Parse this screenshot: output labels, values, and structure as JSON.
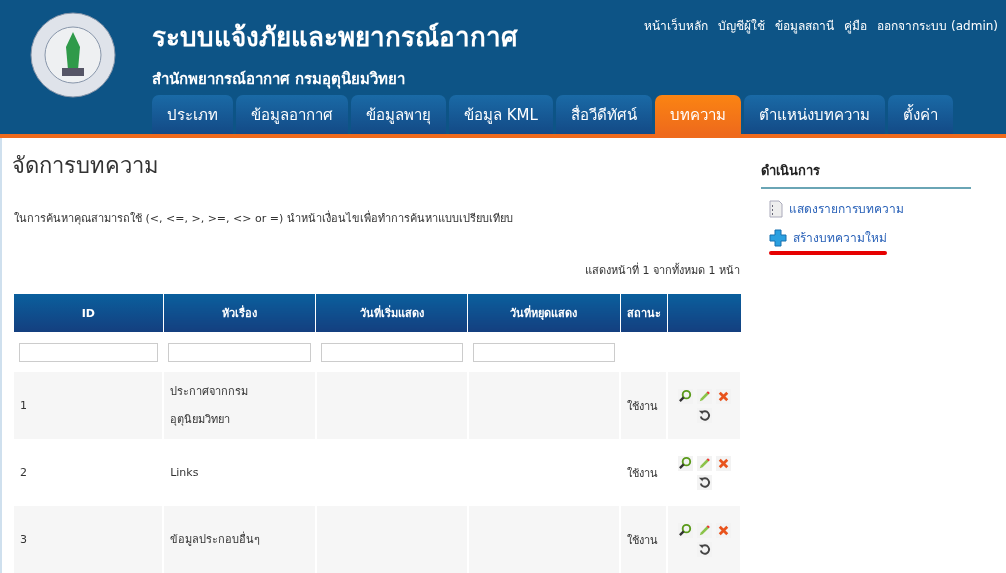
{
  "header": {
    "title": "ระบบแจ้งภัยและพยากรณ์อากาศ",
    "subtitle": "สำนักพยากรณ์อากาศ กรมอุตุนิยมวิทยา",
    "top_links": [
      "หน้าเว็บหลัก",
      "บัญชีผู้ใช้",
      "ข้อมูลสถานี",
      "คู่มือ",
      "ออกจากระบบ (admin)"
    ]
  },
  "tabs": [
    {
      "label": "ประเภท",
      "selected": false
    },
    {
      "label": "ข้อมูลอากาศ",
      "selected": false
    },
    {
      "label": "ข้อมูลพายุ",
      "selected": false
    },
    {
      "label": "ข้อมูล KML",
      "selected": false
    },
    {
      "label": "สื่อวีดีทัศน์",
      "selected": false
    },
    {
      "label": "บทความ",
      "selected": true
    },
    {
      "label": "ตำแหน่งบทความ",
      "selected": false
    },
    {
      "label": "ตั้งค่า",
      "selected": false
    }
  ],
  "page_title": "จัดการบทความ",
  "hint": "ในการค้นหาคุณสามารถใช้ (<, <=, >, >=, <> or =) นำหน้าเงื่อนไขเพื่อทำการค้นหาแบบเปรียบเทียบ",
  "pager": "แสดงหน้าที่ 1 จากทั้งหมด 1 หน้า",
  "table": {
    "columns": [
      "ID",
      "หัวเรื่อง",
      "วันที่เริ่มแสดง",
      "วันที่หยุดแสดง",
      "สถานะ"
    ],
    "rows": [
      {
        "id": "1",
        "title": [
          "ประกาศจากกรม",
          "อุตุนิยมวิทยา"
        ],
        "status": "ใช้งาน"
      },
      {
        "id": "2",
        "title": [
          "Links"
        ],
        "status": "ใช้งาน"
      },
      {
        "id": "3",
        "title": [
          "ข้อมูลประกอบอื่นๆ"
        ],
        "status": "ใช้งาน"
      }
    ]
  },
  "sidebar": {
    "title": "ดำเนินการ",
    "items": [
      {
        "kind": "list",
        "label": "แสดงรายการบทความ",
        "highlighted": false
      },
      {
        "kind": "add",
        "label": "สร้างบทความใหม่",
        "highlighted": true
      }
    ]
  }
}
